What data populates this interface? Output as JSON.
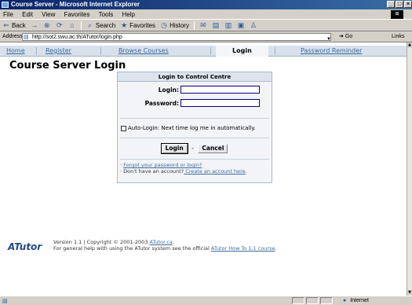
{
  "window": {
    "title": "Course Server - Microsoft Internet Explorer",
    "controls": [
      "_",
      "□",
      "×"
    ]
  },
  "menu": [
    "File",
    "Edit",
    "View",
    "Favorites",
    "Tools",
    "Help"
  ],
  "toolbar": {
    "back": "Back",
    "forward": "→",
    "search": "Search",
    "favorites": "Favorites",
    "history": "History"
  },
  "address": {
    "label": "Address",
    "url": "http://sot2.swu.ac.th/ATutor/login.php",
    "go": "Go",
    "links": "Links"
  },
  "nav": {
    "home": "Home",
    "register": "Register",
    "browse": "Browse Courses",
    "login": "Login",
    "reminder": "Password Reminder"
  },
  "page": {
    "title": "Course Server Login"
  },
  "login_box": {
    "header": "Login to Control Centre",
    "login_label": "Login:",
    "password_label": "Password:",
    "login_value": "",
    "password_value": "",
    "auto_login": "Auto-Login: Next time log me in automatically.",
    "auto_login_checked": false,
    "login_button": "Login",
    "separator": "-",
    "cancel_button": "Cancel",
    "forgot_prefix": "· ",
    "forgot_link": "Forgot your password or login?",
    "no_account": "· Don't have an account?",
    "create_link": " Create an account here",
    "create_suffix": "."
  },
  "footer": {
    "logo": "ATutor",
    "line1_prefix": "Version 1.1 | Copyright © 2001-2003 ",
    "line1_link": "ATutor.ca",
    "line1_suffix": ".",
    "line2_prefix": "For general help with using the ATutor system see the official ",
    "line2_link": "ATutor How To 1.1 course",
    "line2_suffix": "."
  },
  "status": {
    "zone": "Internet"
  }
}
